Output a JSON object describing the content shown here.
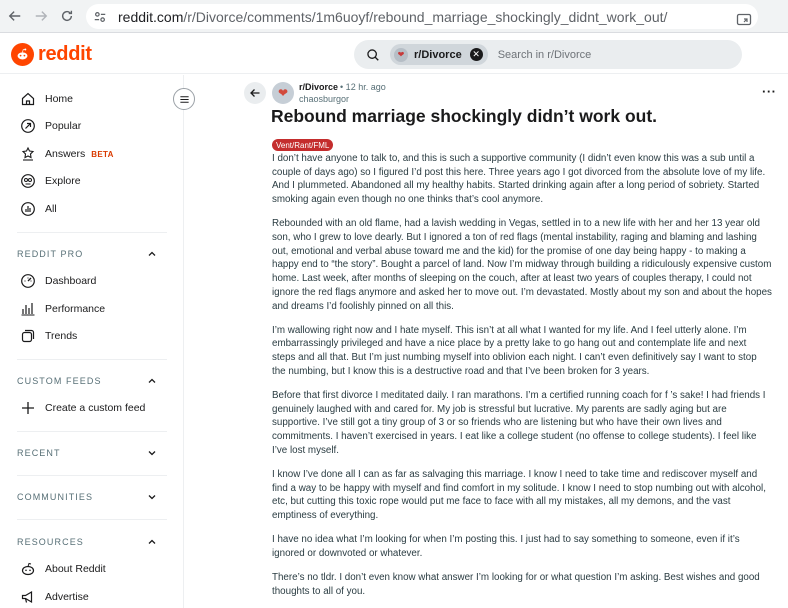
{
  "browser": {
    "url_host": "reddit.com",
    "url_path": "/r/Divorce/comments/1m6uoyf/rebound_marriage_shockingly_didnt_work_out/"
  },
  "header": {
    "logo_text": "reddit",
    "search": {
      "chip_label": "r/Divorce",
      "placeholder": "Search in r/Divorce"
    }
  },
  "sidebar": {
    "main_items": [
      {
        "label": "Home",
        "icon": "home-icon"
      },
      {
        "label": "Popular",
        "icon": "popular-icon"
      },
      {
        "label": "Answers",
        "icon": "answers-icon",
        "badge": "BETA"
      },
      {
        "label": "Explore",
        "icon": "explore-icon"
      },
      {
        "label": "All",
        "icon": "all-icon"
      }
    ],
    "reddit_pro": {
      "title": "REDDIT PRO",
      "items": [
        {
          "label": "Dashboard",
          "icon": "dashboard-icon"
        },
        {
          "label": "Performance",
          "icon": "performance-icon"
        },
        {
          "label": "Trends",
          "icon": "trends-icon"
        }
      ]
    },
    "custom_feeds": {
      "title": "CUSTOM FEEDS",
      "items": [
        {
          "label": "Create a custom feed",
          "icon": "plus-icon"
        }
      ]
    },
    "recent": {
      "title": "RECENT"
    },
    "communities": {
      "title": "COMMUNITIES"
    },
    "resources": {
      "title": "RESOURCES",
      "items": [
        {
          "label": "About Reddit",
          "icon": "reddit-icon"
        },
        {
          "label": "Advertise",
          "icon": "advertise-icon"
        }
      ]
    }
  },
  "post": {
    "subreddit": "r/Divorce",
    "time": "• 12 hr. ago",
    "author": "chaosburgor",
    "title": "Rebound marriage shockingly didn’t work out.",
    "flair": "Vent/Rant/FML",
    "paragraphs": [
      "I don’t have anyone to talk to, and this is such a supportive community (I didn’t even know this was a sub until a couple of days ago) so I figured I’d post this here. Three years ago I got divorced from the absolute love of my life. And I plummeted. Abandoned all my healthy habits. Started drinking again after a long period of sobriety. Started smoking again even though no one thinks that’s cool anymore.",
      "Rebounded with an old flame, had a lavish wedding in Vegas, settled in to a new life with her and her 13 year old son, who I grew to love dearly. But I ignored a    ton of red flags (mental instability, raging and blaming and lashing out, emotional and verbal abuse toward me and the kid) for the promise of one day being happy - to making a happy end to “the story”. Bought a parcel of land. Now I’m midway through building a ridiculously expensive custom home. Last week, after months of sleeping on the couch, after at least two years of couples therapy, I could not ignore the red flags anymore and asked her to move out. I’m devastated. Mostly about my son and about the hopes and dreams I’d foolishly pinned on all this.",
      "I’m wallowing right now and I hate myself. This isn’t at all what I wanted for my life. And I feel utterly alone. I’m embarrassingly privileged and have a nice place by a pretty lake to go hang out and contemplate life and next steps and all that. But I’m just numbing myself into oblivion each night. I can’t even definitively say I want to stop the numbing, but I know this is a destructive road and that I’ve been broken for 3 years.",
      "Before that first divorce I meditated daily. I ran marathons. I’m a certified running coach for f   ’s sake! I had friends I genuinely laughed with and cared for. My job is stressful but lucrative. My parents are sadly aging but are supportive. I’ve still got a tiny group of 3 or so friends who are listening but who have their own lives and commitments. I haven’t exercised in years. I eat like a college student (no offense to college students). I feel like I’ve lost myself.",
      "I know I’ve done all I can as far as salvaging this marriage. I know I need to take time and rediscover myself and find a way to be happy with myself and find comfort in my solitude. I know I need to stop numbing out with alcohol, etc, but cutting this toxic rope would put me face to face with all my mistakes, all my demons, and the vast emptiness of everything.",
      "I have no idea what I’m looking for when I’m posting this. I just had to say something to someone, even if it’s ignored or downvoted or whatever.",
      "There’s no tldr. I don’t even know what answer I’m looking for or what question I’m asking. Best wishes and good thoughts to all of you."
    ]
  },
  "colors": {
    "brand": "#ff4500",
    "flair": "#c42d2d",
    "beta": "#d93a00"
  }
}
